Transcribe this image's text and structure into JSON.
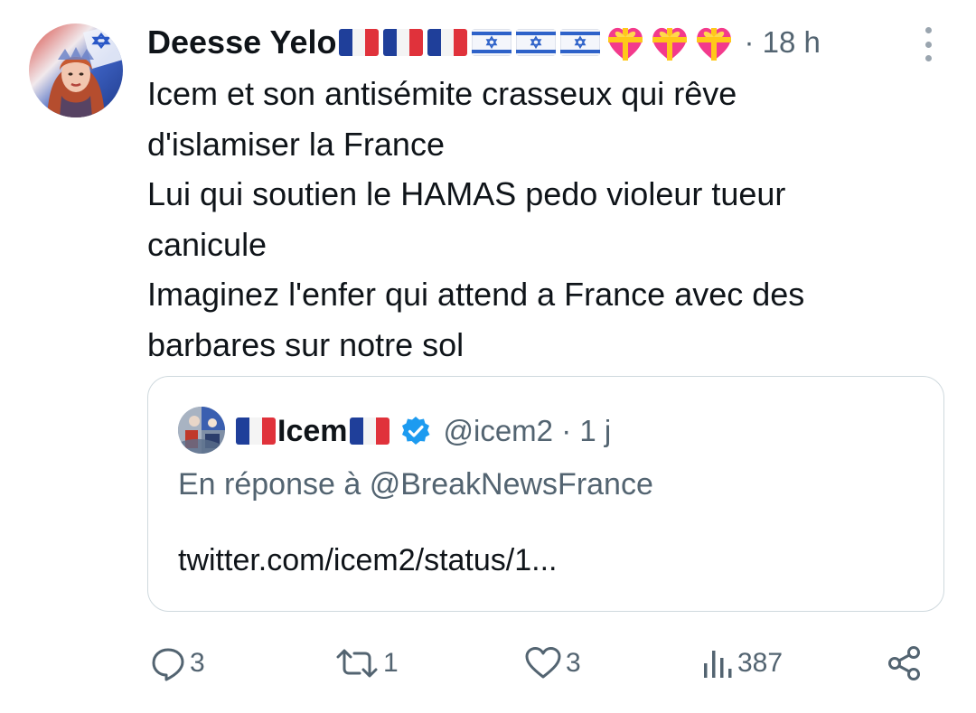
{
  "author": {
    "display_name": "Deesse Yelo",
    "time": "· 18 h",
    "emoji_decor": [
      "flag-france",
      "flag-france",
      "flag-france",
      "flag-israel",
      "flag-israel",
      "flag-israel",
      "heart-with-ribbon",
      "heart-with-ribbon",
      "heart-with-ribbon"
    ]
  },
  "body": {
    "lines": [
      "Icem et son antisémite crasseux qui rêve",
      "d'islamiser la France",
      "Lui qui soutien le HAMAS pedo violeur tueur",
      "canicule",
      "Imaginez l'enfer qui attend a France avec des",
      "barbares sur notre sol"
    ]
  },
  "quoted": {
    "display_name": "Icem",
    "handle": "@icem2 · 1 j",
    "reply_to": "En réponse à @BreakNewsFrance",
    "link": "twitter.com/icem2/status/1..."
  },
  "actions": {
    "replies": "3",
    "reposts": "1",
    "likes": "3",
    "views": "387"
  },
  "colors": {
    "text": "#0f1419",
    "muted": "#536471",
    "border": "#cfd9de",
    "verified": "#1d9bf0",
    "france_blue": "#1f3f9a",
    "france_red": "#e0323b",
    "israel_blue": "#2e62c9",
    "heart": "#f33a8c",
    "ribbon": "#ffc81a"
  }
}
